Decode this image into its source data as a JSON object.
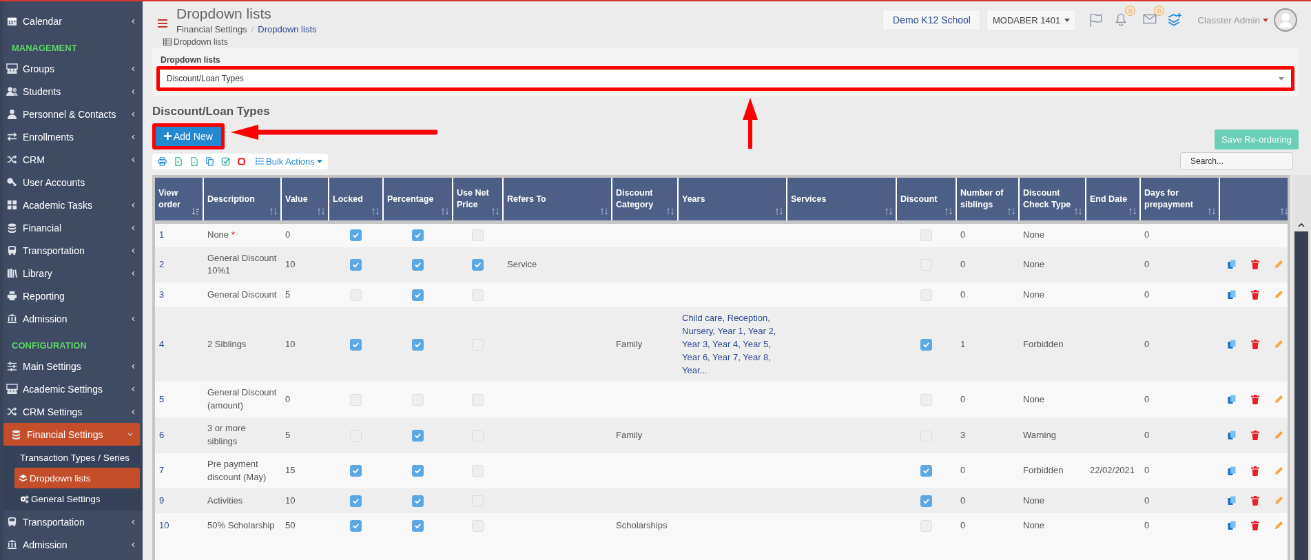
{
  "sidebar": {
    "items": [
      {
        "kind": "menu",
        "label": "Calendar",
        "expanded": false,
        "selected": false
      },
      {
        "kind": "section",
        "label": "MANAGEMENT"
      },
      {
        "kind": "menu",
        "label": "Groups",
        "expanded": false,
        "selected": false
      },
      {
        "kind": "menu",
        "label": "Students",
        "expanded": false,
        "selected": false
      },
      {
        "kind": "menu",
        "label": "Personnel & Contacts",
        "expanded": false,
        "selected": false
      },
      {
        "kind": "menu",
        "label": "Enrollments",
        "expanded": false,
        "selected": false
      },
      {
        "kind": "menu",
        "label": "CRM",
        "expanded": false,
        "selected": false
      },
      {
        "kind": "link",
        "label": "User Accounts",
        "selected": false
      },
      {
        "kind": "menu",
        "label": "Academic Tasks",
        "expanded": false,
        "selected": false
      },
      {
        "kind": "menu",
        "label": "Financial",
        "expanded": false,
        "selected": false
      },
      {
        "kind": "menu",
        "label": "Transportation",
        "expanded": false,
        "selected": false
      },
      {
        "kind": "menu",
        "label": "Library",
        "expanded": false,
        "selected": false
      },
      {
        "kind": "link",
        "label": "Reporting",
        "selected": false
      },
      {
        "kind": "menu",
        "label": "Admission",
        "expanded": false,
        "selected": false
      },
      {
        "kind": "section",
        "label": "CONFIGURATION"
      },
      {
        "kind": "menu",
        "label": "Main Settings",
        "expanded": false,
        "selected": false
      },
      {
        "kind": "menu",
        "label": "Academic Settings",
        "expanded": false,
        "selected": false
      },
      {
        "kind": "menu",
        "label": "CRM Settings",
        "expanded": false,
        "selected": false
      },
      {
        "kind": "menu",
        "label": "Financial Settings",
        "expanded": true,
        "selected": true,
        "children": [
          {
            "label": "Transaction Types / Series",
            "selected": false
          },
          {
            "label": "Dropdown lists",
            "selected": true
          },
          {
            "label": "General Settings",
            "selected": false
          }
        ]
      },
      {
        "kind": "menu",
        "label": "Transportation",
        "expanded": false,
        "selected": false
      },
      {
        "kind": "menu",
        "label": "Admission",
        "expanded": false,
        "selected": false
      }
    ]
  },
  "header": {
    "title": "Dropdown lists",
    "breadcrumb": [
      "Financial Settings",
      "Dropdown lists"
    ],
    "breadcrumb_separator": "/",
    "school": "Demo K12 School",
    "year": "MODABER 1401",
    "notifications_badge": "0",
    "messages_badge": "0",
    "user": "Classter Admin"
  },
  "panel": {
    "tab": "Dropdown lists",
    "label": "Dropdown lists",
    "value": "Discount/Loan Types"
  },
  "section_title": "Discount/Loan Types",
  "add_button": "Add New",
  "save_button": {
    "label": "Save Re-ordering",
    "disabled": true
  },
  "toolbar": {
    "bulk_actions": "Bulk Actions"
  },
  "search": {
    "placeholder": "Search..."
  },
  "table": {
    "columns": [
      {
        "label": "View order",
        "sorted": true
      },
      {
        "label": "Description",
        "sorted": false
      },
      {
        "label": "Value",
        "sorted": false
      },
      {
        "label": "Locked",
        "sorted": false
      },
      {
        "label": "Percentage",
        "sorted": false
      },
      {
        "label": "Use Net Price",
        "sorted": false
      },
      {
        "label": "Refers To",
        "sorted": false
      },
      {
        "label": "Discount Category",
        "sorted": false
      },
      {
        "label": "Years",
        "sorted": false
      },
      {
        "label": "Services",
        "sorted": false
      },
      {
        "label": "Discount",
        "sorted": false
      },
      {
        "label": "Number of siblings",
        "sorted": false
      },
      {
        "label": "Discount Check Type",
        "sorted": false
      },
      {
        "label": "End Date",
        "sorted": false
      },
      {
        "label": "Days for prepayment",
        "sorted": false
      },
      {
        "sorted": false
      }
    ],
    "rows": [
      {
        "order": "1",
        "description": "None",
        "required_mark": "*",
        "value": "0",
        "locked": true,
        "percentage": true,
        "use_net_price": false,
        "discount": false,
        "siblings": "0",
        "check_type": "None",
        "days": "0",
        "actions": false
      },
      {
        "order": "2",
        "description": "General Discount 10%1",
        "value": "10",
        "locked": true,
        "percentage": true,
        "use_net_price": true,
        "refers_to": "Service",
        "discount": false,
        "siblings": "0",
        "check_type": "None",
        "days": "0",
        "actions": true
      },
      {
        "order": "3",
        "description": "General Discount",
        "value": "5",
        "locked": false,
        "percentage": true,
        "use_net_price": false,
        "discount": false,
        "siblings": "0",
        "check_type": "None",
        "days": "0",
        "actions": true
      },
      {
        "order": "4",
        "description": "2 Siblings",
        "value": "10",
        "locked": true,
        "percentage": true,
        "use_net_price": false,
        "category": "Family",
        "years": "Child care, Reception, Nursery, Year 1, Year 2, Year 3, Year 4, Year 5, Year 6, Year 7, Year 8, Year...",
        "discount": true,
        "siblings": "1",
        "check_type": "Forbidden",
        "days": "0",
        "actions": true
      },
      {
        "order": "5",
        "description": "General Discount (amount)",
        "value": "0",
        "locked": false,
        "percentage": false,
        "use_net_price": false,
        "discount": false,
        "siblings": "0",
        "check_type": "None",
        "days": "0",
        "actions": true
      },
      {
        "order": "6",
        "description": "3 or more siblings",
        "value": "5",
        "locked": false,
        "percentage": true,
        "use_net_price": false,
        "category": "Family",
        "discount": false,
        "siblings": "3",
        "check_type": "Warning",
        "days": "0",
        "actions": true
      },
      {
        "order": "7",
        "description": "Pre payment discount (May)",
        "value": "15",
        "locked": true,
        "percentage": true,
        "use_net_price": false,
        "discount": true,
        "siblings": "0",
        "check_type": "Forbidden",
        "end_date": "22/02/2021",
        "days": "0",
        "actions": true
      },
      {
        "order": "9",
        "description": "Activities",
        "value": "10",
        "locked": true,
        "percentage": true,
        "use_net_price": false,
        "discount": true,
        "siblings": "0",
        "check_type": "None",
        "days": "0",
        "actions": true
      },
      {
        "order": "10",
        "description": "50% Scholarship",
        "value": "50",
        "locked": true,
        "percentage": true,
        "use_net_price": false,
        "category": "Scholarships",
        "discount": false,
        "siblings": "0",
        "check_type": "None",
        "days": "0",
        "actions": true
      }
    ]
  }
}
